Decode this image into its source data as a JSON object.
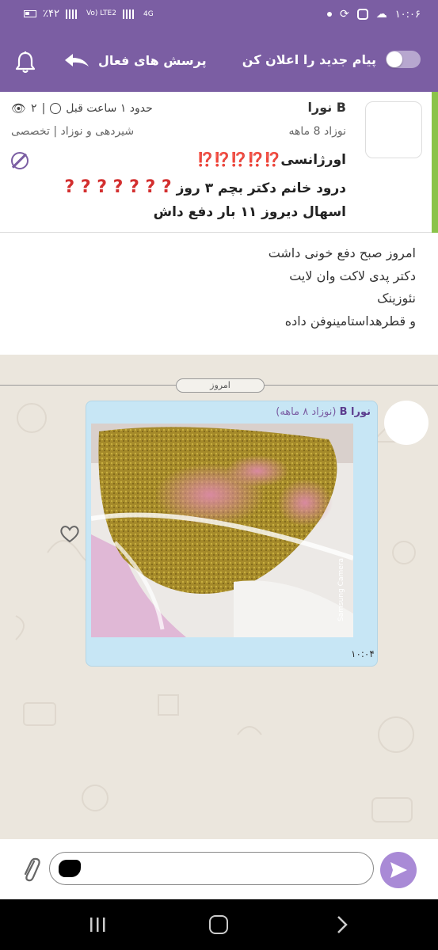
{
  "status_bar": {
    "battery": "٪۴۲",
    "network_label": "Vo) LTE2",
    "network_4g": "4G",
    "time": "۱۰:۰۶"
  },
  "toolbar": {
    "active_questions": "پرسش های فعال",
    "notify_new_message": "پیام جدید را اعلان کن",
    "notify_toggle_on": false
  },
  "question": {
    "user": "نورا B",
    "baby_age": "نوزاد 8 ماهه",
    "time_ago": "حدود ۱ ساعت قبل",
    "views": "۲",
    "category": "شیردهی و نوزاد | تخصصی",
    "line1_text": "اورژانسی",
    "line1_marks": "⁉️⁉️⁉️⁉️⁉️",
    "line2_text": "درود خانم دکتر بچم ۳ روز",
    "line2_marks": "? ? ? ? ? ? ?",
    "line3_text": "اسهال دیروز ۱۱ بار دفع داش"
  },
  "body": {
    "lines": [
      "امروز صبح دفع خونی داشت",
      "دکتر پدی لاکت وان لایت",
      "نئوزینک",
      "و قطرهداستامینوفن داده"
    ]
  },
  "chat": {
    "date_label": "امروز",
    "message": {
      "sender": "نورا B",
      "sender_detail": "(نوزاد ۸ ماهه)",
      "time": "۱۰:۰۴",
      "photo_watermark": "Samsung Camera"
    }
  },
  "input": {
    "value": "",
    "placeholder": ""
  },
  "colors": {
    "primary": "#7b5ea3",
    "accent_green": "#8bc34a",
    "bubble": "#c7e6f5",
    "send": "#a98ad6"
  }
}
